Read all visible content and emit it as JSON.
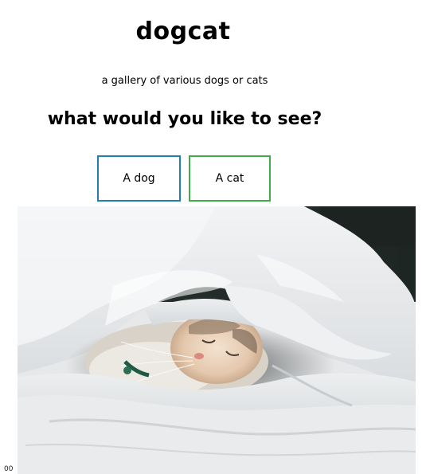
{
  "header": {
    "title": "dogcat",
    "tagline": "a gallery of various dogs or cats"
  },
  "main": {
    "question": "what would you like to see?",
    "buttons": {
      "dog_label": "A dog",
      "cat_label": "A cat"
    },
    "image": {
      "subject": "cat sleeping under white blanket"
    }
  },
  "footer": {
    "corner_text": "00"
  },
  "colors": {
    "dog_button_border": "#1f7fb3",
    "cat_button_border": "#3fae49",
    "background": "#ffffff"
  }
}
